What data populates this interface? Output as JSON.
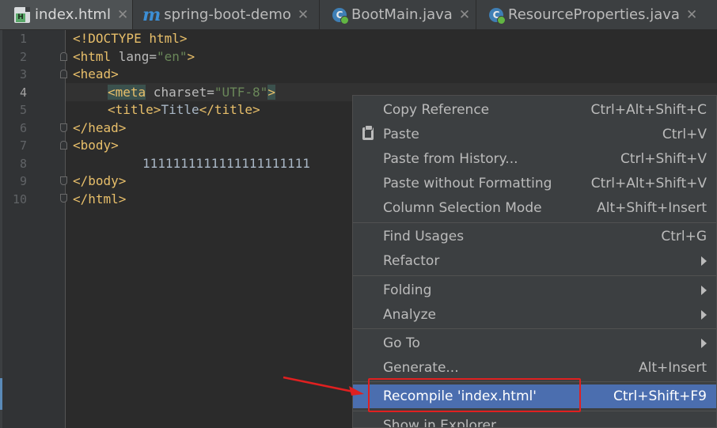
{
  "tabs": [
    {
      "label": "index.html",
      "icon": "html-file-icon",
      "active": true
    },
    {
      "label": "spring-boot-demo",
      "icon": "maven-module-icon",
      "active": false
    },
    {
      "label": "BootMain.java",
      "icon": "java-class-icon",
      "active": false
    },
    {
      "label": "ResourceProperties.java",
      "icon": "java-class-icon",
      "active": false
    }
  ],
  "close_glyph": "✕",
  "gutter": {
    "line_numbers": [
      "1",
      "2",
      "3",
      "4",
      "5",
      "6",
      "7",
      "8",
      "9",
      "10"
    ]
  },
  "code": {
    "l1": "<!DOCTYPE html>",
    "l2_open": "<html ",
    "l2_attr": "lang=",
    "l2_val": "\"en\"",
    "l2_close": ">",
    "l3": "<head>",
    "l4_open": "<meta",
    "l4_attr": " charset=",
    "l4_val": "\"UTF-8\"",
    "l4_close": ">",
    "l5_open": "<title>",
    "l5_text": "Title",
    "l5_close": "</title>",
    "l6": "</head>",
    "l7": "<body>",
    "l8": "1111111111111111111111",
    "l9": "</body>",
    "l10": "</html>"
  },
  "context_menu": {
    "items": [
      {
        "label": "Copy Reference",
        "shortcut": "Ctrl+Alt+Shift+C"
      },
      {
        "label": "Paste",
        "shortcut": "Ctrl+V",
        "icon": "clipboard-icon"
      },
      {
        "label": "Paste from History...",
        "shortcut": "Ctrl+Shift+V"
      },
      {
        "label": "Paste without Formatting",
        "shortcut": "Ctrl+Alt+Shift+V"
      },
      {
        "label": "Column Selection Mode",
        "shortcut": "Alt+Shift+Insert"
      },
      {
        "label": "Find Usages",
        "shortcut": "Ctrl+G"
      },
      {
        "label": "Refactor",
        "submenu": true
      },
      {
        "label": "Folding",
        "submenu": true
      },
      {
        "label": "Analyze",
        "submenu": true
      },
      {
        "label": "Go To",
        "submenu": true
      },
      {
        "label": "Generate...",
        "shortcut": "Alt+Insert"
      },
      {
        "label": "Recompile 'index.html'",
        "shortcut": "Ctrl+Shift+F9",
        "selected": true
      },
      {
        "label": "Show in Explorer",
        "shortcut": ""
      }
    ]
  },
  "colors": {
    "editor_bg": "#2b2b2b",
    "menu_bg": "#3c3f41",
    "selection": "#4b6eaf",
    "annotation_red": "#e02020",
    "tag": "#e8bf6a",
    "string": "#6a8759"
  }
}
